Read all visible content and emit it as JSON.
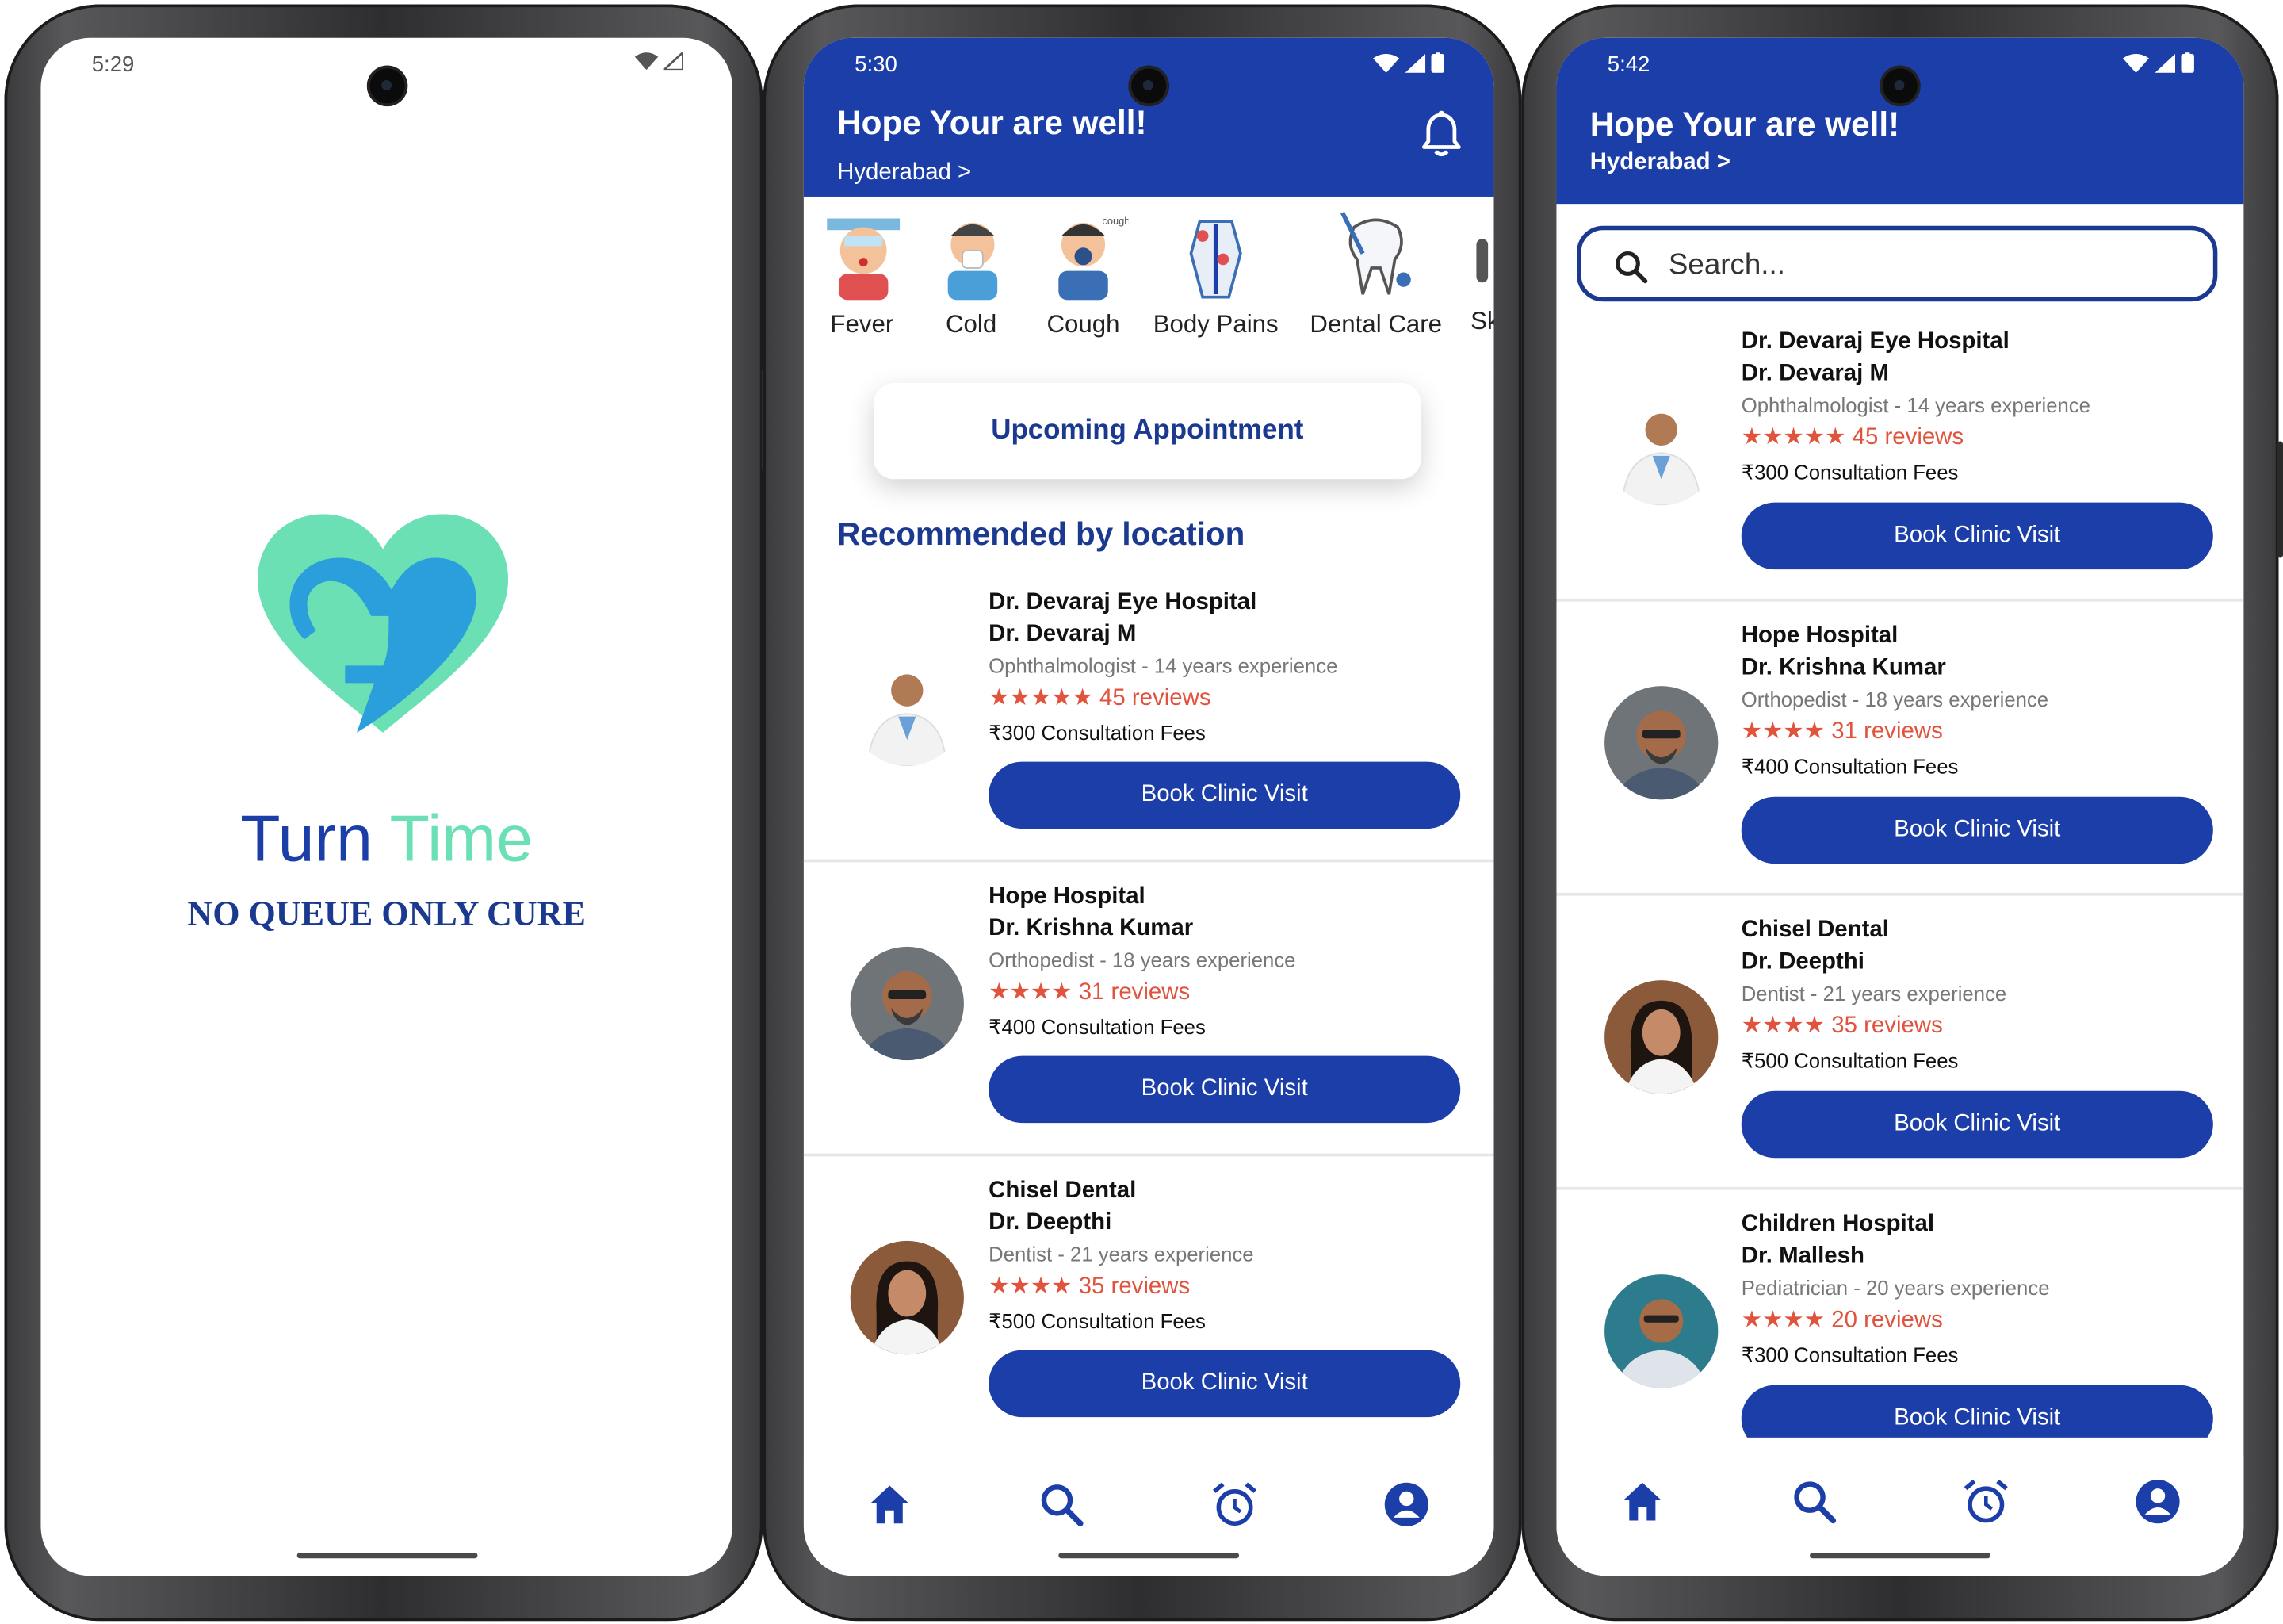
{
  "splash": {
    "time": "5:29",
    "brand_turn": "Turn",
    "brand_time": "Time",
    "tagline": "NO QUEUE ONLY CURE",
    "logo_icon": "heart-logo-icon"
  },
  "home": {
    "time": "5:30",
    "greeting": "Hope Your are well!",
    "location": "Hyderabad >",
    "categories": [
      {
        "label": "Fever",
        "icon": "fever-icon"
      },
      {
        "label": "Cold",
        "icon": "cold-icon"
      },
      {
        "label": "Cough",
        "icon": "cough-icon"
      },
      {
        "label": "Body Pains",
        "icon": "body-pains-icon"
      },
      {
        "label": "Dental Care",
        "icon": "dental-care-icon"
      },
      {
        "label": "Sk",
        "icon": "skin-icon"
      }
    ],
    "upcoming_label": "Upcoming Appointment",
    "section_title": "Recommended by location",
    "book_label": "Book Clinic Visit"
  },
  "search": {
    "time": "5:42",
    "greeting": "Hope Your are well!",
    "location": "Hyderabad >",
    "placeholder": "Search..."
  },
  "doctors": [
    {
      "hospital": "Dr. Devaraj Eye Hospital",
      "doctor": "Dr. Devaraj M",
      "specialty": "Ophthalmologist - 14 years experience",
      "stars": "★★★★★",
      "reviews": "45 reviews",
      "fee": "₹300 Consultation Fees",
      "avatar_bg": "#ffffff",
      "skin": "#b07a55"
    },
    {
      "hospital": "Hope Hospital",
      "doctor": "Dr. Krishna Kumar",
      "specialty": "Orthopedist - 18 years experience",
      "stars": "★★★★",
      "reviews": "31 reviews",
      "fee": "₹400 Consultation Fees",
      "avatar_bg": "#6f7478",
      "skin": "#a36b4a"
    },
    {
      "hospital": "Chisel Dental",
      "doctor": "Dr. Deepthi",
      "specialty": "Dentist - 21 years experience",
      "stars": "★★★★",
      "reviews": "35 reviews",
      "fee": "₹500 Consultation Fees",
      "avatar_bg": "#8a5a3a",
      "skin": "#c58b68"
    },
    {
      "hospital": "Children Hospital",
      "doctor": "Dr. Mallesh",
      "specialty": "Pediatrician - 20 years experience",
      "stars": "★★★★",
      "reviews": "20 reviews",
      "fee": "₹300 Consultation Fees",
      "avatar_bg": "#2c7c8e",
      "skin": "#a66b47"
    }
  ],
  "nav": [
    {
      "icon": "home-icon"
    },
    {
      "icon": "search-icon"
    },
    {
      "icon": "alarm-clock-icon"
    },
    {
      "icon": "profile-icon"
    }
  ],
  "colors": {
    "primary": "#1c3ea8",
    "brand_teal": "#6ae0b4",
    "brand_blue": "#2a9fdc",
    "rating": "#e0533d"
  }
}
